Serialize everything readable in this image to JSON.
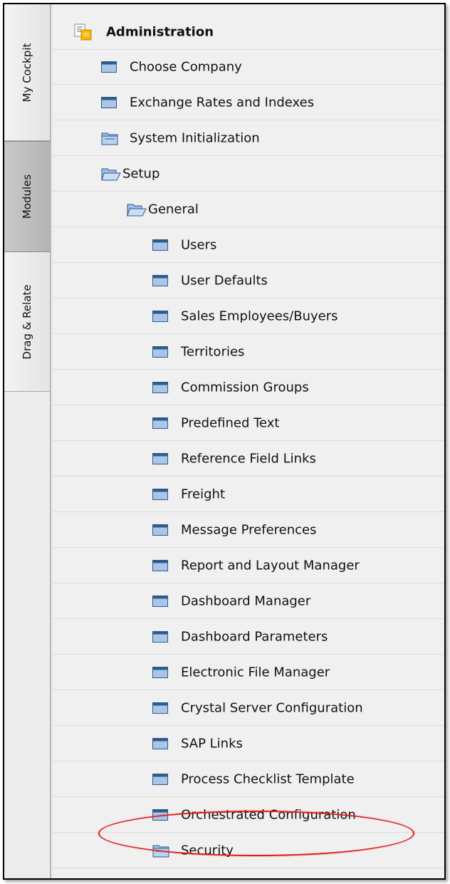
{
  "tabs": [
    {
      "label": "My Cockpit",
      "active": false
    },
    {
      "label": "Modules",
      "active": true
    },
    {
      "label": "Drag & Relate",
      "active": false
    }
  ],
  "tree": {
    "root": "Administration",
    "level1": [
      "Choose Company",
      "Exchange Rates and Indexes"
    ],
    "system_initialization": "System Initialization",
    "setup": "Setup",
    "general": "General",
    "general_items": [
      "Users",
      "User Defaults",
      "Sales Employees/Buyers",
      "Territories",
      "Commission Groups",
      "Predefined Text",
      "Reference Field Links",
      "Freight",
      "Message Preferences",
      "Report and Layout Manager",
      "Dashboard Manager",
      "Dashboard Parameters",
      "Electronic File Manager",
      "Crystal Server Configuration",
      "SAP Links",
      "Process Checklist Template",
      "Orchestrated Configuration"
    ],
    "security": "Security"
  },
  "highlight": {
    "item": "Orchestrated Configuration",
    "color": "#e01b1b"
  },
  "icons": {
    "root": "module-icon",
    "item": "form-icon",
    "folder_closed": "folder-closed-icon",
    "folder_open": "folder-open-icon"
  }
}
